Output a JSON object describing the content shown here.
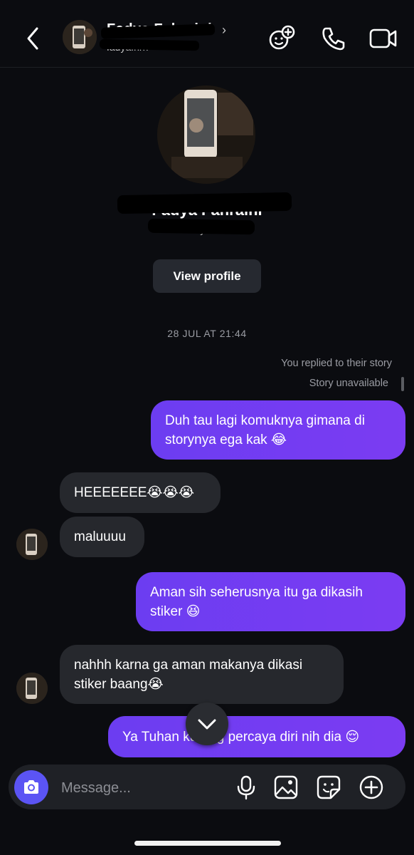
{
  "header": {
    "name": "Fadya Fahraini",
    "subtitle": "fadyafhrn",
    "icons": [
      "back-icon",
      "add-people-icon",
      "phone-icon",
      "video-icon"
    ]
  },
  "profile": {
    "name": "Fadya Fahraini",
    "subtitle": "fadyafhrn",
    "view_profile_label": "View profile"
  },
  "thread": {
    "timestamp": "28 JUL AT 21:44",
    "replied_note": "You replied to their story",
    "story_unavailable": "Story unavailable",
    "messages": [
      {
        "side": "out",
        "text": "Duh tau lagi komuknya gimana di storynya ega kak 😂"
      },
      {
        "side": "in",
        "text": "HEEEEEEE😭😭😭"
      },
      {
        "side": "in",
        "text": "maluuuu"
      },
      {
        "side": "out",
        "text": "Aman sih seherusnya itu ga dikasih stiker 😆"
      },
      {
        "side": "in",
        "text": "nahhh karna ga aman makanya dikasi stiker baang😭"
      },
      {
        "side": "out",
        "text": "Ya Tuhan kurang percaya diri nih dia 😌"
      }
    ]
  },
  "composer": {
    "placeholder": "Message...",
    "icons": [
      "camera-icon",
      "microphone-icon",
      "gallery-icon",
      "sticker-icon",
      "plus-icon"
    ]
  },
  "colors": {
    "background": "#0b0c10",
    "outgoing_bubble": "#7a3cf4",
    "incoming_bubble": "#26282d",
    "camera_button": "#5b54f4"
  }
}
